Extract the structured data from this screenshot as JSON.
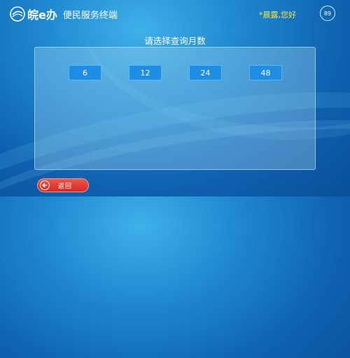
{
  "header": {
    "logo_text": "皖e办",
    "subtitle": "便民服务终端",
    "greeting": "*晨露,您好",
    "countdown": "89"
  },
  "main": {
    "title": "请选择查询月数",
    "months": [
      "6",
      "12",
      "24",
      "48"
    ]
  },
  "footer": {
    "back_label": "返回"
  },
  "colors": {
    "background": "#1d86cf",
    "month_button": "#1e8ee5",
    "back_button": "#e23b32",
    "greeting": "#f5e44a"
  }
}
